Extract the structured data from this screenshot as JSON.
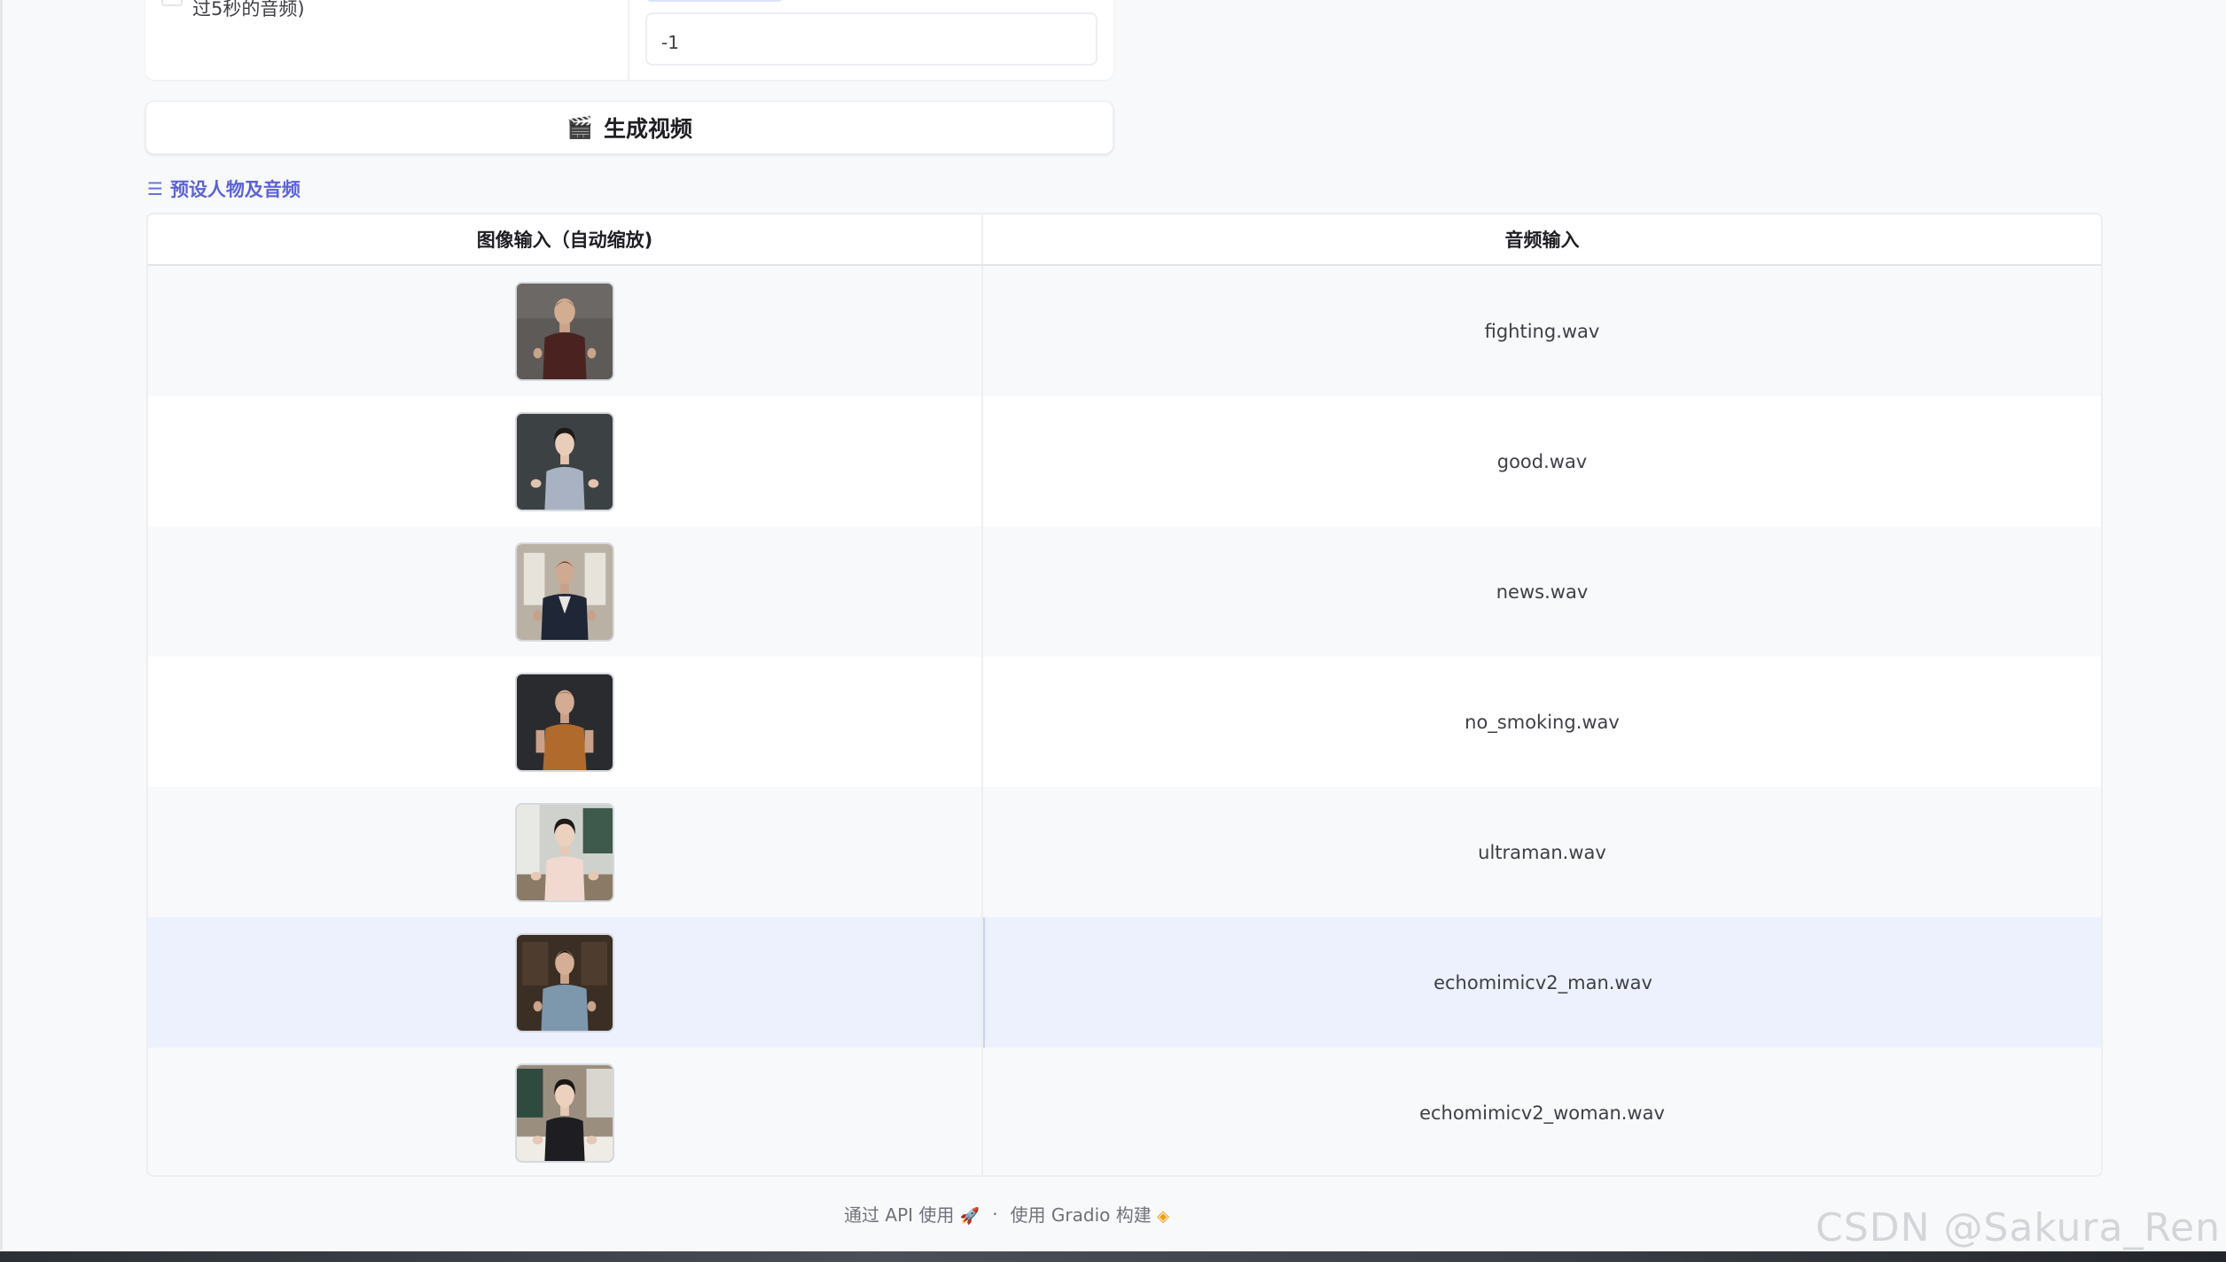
{
  "settings": {
    "checkbox_label": "过5秒的音频)",
    "seed_value": "-1"
  },
  "generate_button": {
    "icon": "clapper-board-icon",
    "label": "生成视频"
  },
  "examples": {
    "title": "预设人物及音频",
    "icon": "list-icon",
    "columns": [
      "图像输入（自动缩放)",
      "音频输入"
    ],
    "rows": [
      {
        "image": "portrait-man-maroon-shirt",
        "audio": "fighting.wav"
      },
      {
        "image": "portrait-woman-grey-tee",
        "audio": "good.wav"
      },
      {
        "image": "portrait-man-navy-jacket",
        "audio": "news.wav"
      },
      {
        "image": "portrait-man-orange-vest",
        "audio": "no_smoking.wav"
      },
      {
        "image": "portrait-woman-pink-blouse-classroom",
        "audio": "ultraman.wav"
      },
      {
        "image": "portrait-man-blue-polo",
        "audio": "echomimicv2_man.wav"
      },
      {
        "image": "portrait-woman-black-tee-classroom",
        "audio": "echomimicv2_woman.wav"
      }
    ]
  },
  "footer": {
    "api_link": "通过 API 使用",
    "api_icon": "rocket-icon",
    "separator": "·",
    "built_with": "使用 Gradio 构建",
    "gradio_icon": "gradio-logo-icon"
  },
  "watermark": "CSDN @Sakura_Ren"
}
